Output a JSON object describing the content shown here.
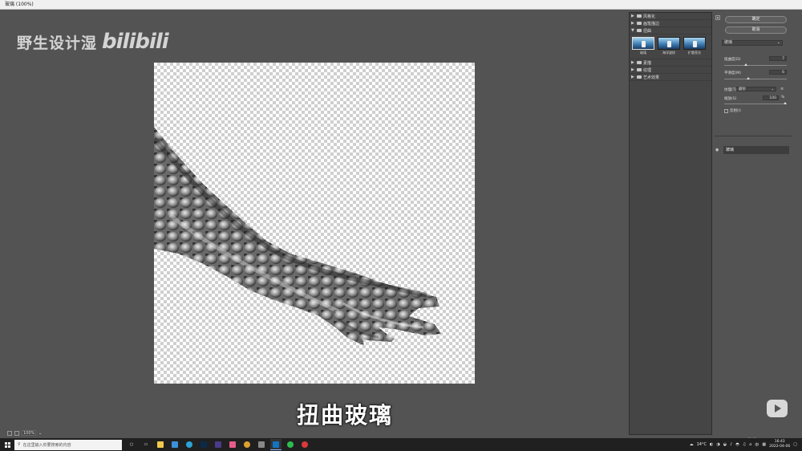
{
  "window": {
    "title": "玻璃 (100%)"
  },
  "watermark": {
    "text": "野生设计湿",
    "brand": "bilibili"
  },
  "subtitle": "扭曲玻璃",
  "zoom": {
    "value": "100%"
  },
  "filter_gallery": {
    "categories": [
      {
        "label": "风格化",
        "expanded": false
      },
      {
        "label": "画笔描边",
        "expanded": false
      },
      {
        "label": "扭曲",
        "expanded": true
      },
      {
        "label": "素描",
        "expanded": false
      },
      {
        "label": "纹理",
        "expanded": false
      },
      {
        "label": "艺术效果",
        "expanded": false
      }
    ],
    "distort_filters": [
      {
        "label": "玻璃",
        "selected": true
      },
      {
        "label": "海洋波纹",
        "selected": false
      },
      {
        "label": "扩散亮光",
        "selected": false
      }
    ]
  },
  "options": {
    "ok_label": "确定",
    "cancel_label": "取消",
    "filter_name": "玻璃",
    "distortion": {
      "label": "扭曲度(D)",
      "value": "7",
      "level": 0.35
    },
    "smoothness": {
      "label": "平滑度(M)",
      "value": "6",
      "level": 0.38
    },
    "texture": {
      "label": "纹理(T)",
      "value": "磨砂"
    },
    "scaling": {
      "label": "缩放(S)",
      "value": "100",
      "unit": "%",
      "level": 0.97
    },
    "invert": {
      "label": "反相(I)",
      "checked": false
    }
  },
  "layers": [
    {
      "name": "玻璃",
      "visible": true
    }
  ],
  "taskbar": {
    "search_placeholder": "在这里输入你要搜索的内容",
    "weather": "14°C",
    "time": "16:43",
    "date": "2022-04-06",
    "ime": "中"
  }
}
